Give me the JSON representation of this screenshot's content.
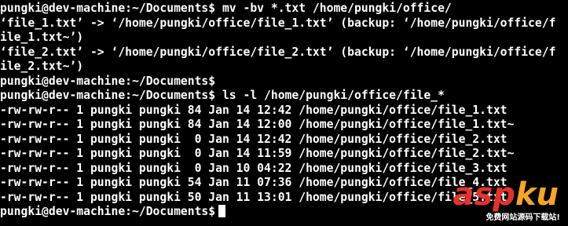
{
  "terminal": {
    "lines": [
      "pungki@dev-machine:~/Documents$ mv -bv *.txt /home/pungki/office/",
      "‘file_1.txt’ -> ‘/home/pungki/office/file_1.txt’ (backup: ‘/home/pungki/office/f",
      "ile_1.txt~’)",
      "‘file_2.txt’ -> ‘/home/pungki/office/file_2.txt’ (backup: ‘/home/pungki/office/f",
      "ile_2.txt~’)",
      "pungki@dev-machine:~/Documents$",
      "pungki@dev-machine:~/Documents$ ls -l /home/pungki/office/file_*",
      "-rw-rw-r-- 1 pungki pungki 84 Jan 14 12:42 /home/pungki/office/file_1.txt",
      "-rw-rw-r-- 1 pungki pungki 84 Jan 14 12:00 /home/pungki/office/file_1.txt~",
      "-rw-rw-r-- 1 pungki pungki  0 Jan 14 12:42 /home/pungki/office/file_2.txt",
      "-rw-rw-r-- 1 pungki pungki  0 Jan 14 11:59 /home/pungki/office/file_2.txt~",
      "-rw-rw-r-- 1 pungki pungki  0 Jan 10 04:22 /home/pungki/office/file_3.txt",
      "-rw-rw-r-- 1 pungki pungki 54 Jan 11 07:36 /home/pungki/office/file_4.txt",
      "-rw-rw-r-- 1 pungki pungki 50 Jan 11 13:01 /home/pungki/office/file_5.txt",
      "pungki@dev-machine:~/Documents$"
    ]
  },
  "watermark": {
    "logo_asp": "asp",
    "logo_ku": "ku",
    "tagline": "免费网站源码下载站!"
  }
}
